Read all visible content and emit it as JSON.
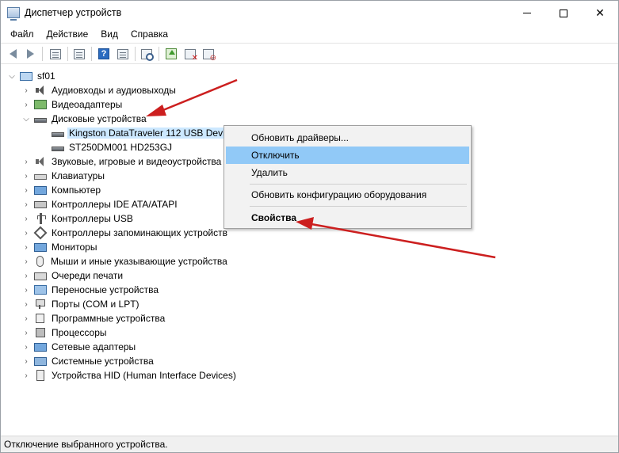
{
  "window": {
    "title": "Диспетчер устройств"
  },
  "menu": [
    "Файл",
    "Действие",
    "Вид",
    "Справка"
  ],
  "toolbar": {
    "icons": [
      "back-arrow-icon",
      "forward-arrow-icon",
      "properties-icon",
      "list-icon",
      "help-icon",
      "view-icon",
      "scan-hardware-icon",
      "update-driver-icon",
      "disable-device-icon",
      "uninstall-device-icon"
    ]
  },
  "tree": {
    "root": "sf01",
    "categories": [
      {
        "label": "Аудиовходы и аудиовыходы",
        "expanded": false
      },
      {
        "label": "Видеоадаптеры",
        "expanded": false
      },
      {
        "label": "Дисковые устройства",
        "expanded": true
      },
      {
        "label": "Звуковые, игровые и видеоустройства",
        "expanded": false
      },
      {
        "label": "Клавиатуры",
        "expanded": false
      },
      {
        "label": "Компьютер",
        "expanded": false
      },
      {
        "label": "Контроллеры IDE ATA/ATAPI",
        "expanded": false
      },
      {
        "label": "Контроллеры USB",
        "expanded": false
      },
      {
        "label": "Контроллеры запоминающих устройств",
        "expanded": false
      },
      {
        "label": "Мониторы",
        "expanded": false
      },
      {
        "label": "Мыши и иные указывающие устройства",
        "expanded": false
      },
      {
        "label": "Очереди печати",
        "expanded": false
      },
      {
        "label": "Переносные устройства",
        "expanded": false
      },
      {
        "label": "Порты (COM и LPT)",
        "expanded": false
      },
      {
        "label": "Программные устройства",
        "expanded": false
      },
      {
        "label": "Процессоры",
        "expanded": false
      },
      {
        "label": "Сетевые адаптеры",
        "expanded": false
      },
      {
        "label": "Системные устройства",
        "expanded": false
      },
      {
        "label": "Устройства HID (Human Interface Devices)",
        "expanded": false
      }
    ],
    "disk_children": [
      {
        "label": "Kingston DataTraveler 112 USB Device",
        "selected": true
      },
      {
        "label": "ST250DM001 HD253GJ",
        "selected": false
      }
    ]
  },
  "context_menu": {
    "items": [
      "Обновить драйверы...",
      "Отключить",
      "Удалить",
      "Обновить конфигурацию оборудования",
      "Свойства"
    ],
    "highlighted": "Отключить",
    "default": "Свойства"
  },
  "statusbar": {
    "text": "Отключение выбранного устройства."
  },
  "colors": {
    "selection": "#cce8ff",
    "menu_highlight": "#91c9f7",
    "annotation_arrow": "#cc1f1f"
  }
}
